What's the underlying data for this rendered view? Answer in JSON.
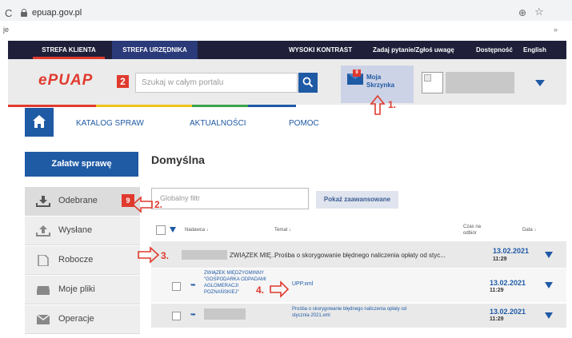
{
  "browser": {
    "url": "epuap.gov.pl",
    "bookmark": "je",
    "more": "»"
  },
  "topnav": {
    "tabs": [
      "STREFA KLIENTA",
      "STREFA URZĘDNIKA"
    ],
    "links": [
      "WYSOKI KONTRAST",
      "Zadaj pytanie/Zgłoś uwagę",
      "Dostępność",
      "English"
    ]
  },
  "header": {
    "logo_text": "ePUAP",
    "logo_badge": "2",
    "search_placeholder": "Szukaj w całym portalu",
    "mailbox_line1": "Moja",
    "mailbox_line2": "Skrzynka",
    "mailbox_badge": "9"
  },
  "colors": {
    "brand_blue": "#1f5aa5",
    "brand_red": "#e03a2e",
    "topnav_bg": "#1f1f3a"
  },
  "menu": [
    "KATALOG SPRAW",
    "AKTUALNOŚCI",
    "POMOC"
  ],
  "sidebar": {
    "cta": "Załatw sprawę",
    "items": [
      {
        "label": "Odebrane",
        "icon": "download-tray-icon"
      },
      {
        "label": "Wysłane",
        "icon": "upload-tray-icon"
      },
      {
        "label": "Robocze",
        "icon": "draft-document-icon"
      },
      {
        "label": "Moje pliki",
        "icon": "drive-icon"
      },
      {
        "label": "Operacje",
        "icon": "envelope-icon"
      }
    ],
    "badge": "9"
  },
  "content": {
    "title": "Domyślna",
    "filter_placeholder": "Globalny filtr",
    "advanced_button": "Pokaż zaawansowane",
    "columns": {
      "sender": "Nadawca ↓",
      "subject": "Temat ↓",
      "time_line1": "Czas na",
      "time_line2": "odbiór",
      "date": "Data ↓"
    },
    "rows": [
      {
        "sender": "ZWIĄZEK MIĘ...",
        "subject": "Prośba o skorygowanie błędnego naliczenia opłaty od styc...",
        "date": "13.02.2021",
        "time": "11:29"
      },
      {
        "sender_lines": [
          "ZWIĄZEK MIĘDZYGMINNY",
          "\"GOSPODARKA ODPADAMI",
          "AGLOMERACJI",
          "POZNAŃSKIEJ\""
        ],
        "subject": "UPP.xml",
        "date": "13.02.2021",
        "time": "11:29"
      },
      {
        "subject_line1": "Prośba o skorygowanie błędnego naliczenia opłaty od",
        "subject_line2": "stycznia 2021.xml",
        "date": "13.02.2021",
        "time": "11:29"
      }
    ]
  },
  "annotations": [
    "1.",
    "2.",
    "3.",
    "4."
  ]
}
